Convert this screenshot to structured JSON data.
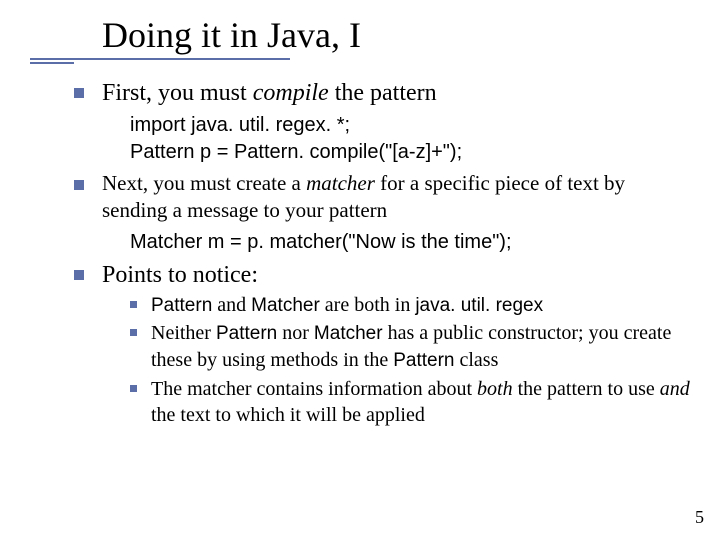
{
  "title": "Doing it in Java, I",
  "items": [
    {
      "pre": "First, you must ",
      "em": "compile",
      "post": " the pattern",
      "code": [
        "import java. util. regex. *;",
        "Pattern p = Pattern. compile(\"[a-z]+\");"
      ]
    },
    {
      "small": true,
      "pre": "Next, you must create a ",
      "em": "matcher",
      "post": " for a specific piece of text by sending a message to your pattern",
      "code": [
        "Matcher m = p. matcher(\"Now is the time\");"
      ]
    },
    {
      "pre": "Points to notice:",
      "sub": [
        {
          "parts": [
            {
              "t": "Pattern",
              "cls": "sans"
            },
            {
              "t": " and "
            },
            {
              "t": "Matcher",
              "cls": "sans"
            },
            {
              "t": " are both in "
            },
            {
              "t": "java. util. regex",
              "cls": "sans"
            }
          ]
        },
        {
          "parts": [
            {
              "t": "Neither "
            },
            {
              "t": "Pattern",
              "cls": "sans"
            },
            {
              "t": " nor "
            },
            {
              "t": "Matcher",
              "cls": "sans"
            },
            {
              "t": " has a public constructor; you create these by using methods in the "
            },
            {
              "t": "Pattern",
              "cls": "sans"
            },
            {
              "t": " class"
            }
          ]
        },
        {
          "parts": [
            {
              "t": "The matcher contains information about "
            },
            {
              "t": "both",
              "cls": "ital"
            },
            {
              "t": " the pattern to use "
            },
            {
              "t": "and",
              "cls": "ital"
            },
            {
              "t": " the text to which it will be applied"
            }
          ]
        }
      ]
    }
  ],
  "pagenum": "5"
}
